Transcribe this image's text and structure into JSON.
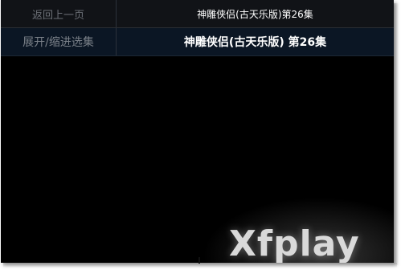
{
  "nav": {
    "back_label": "返回上一页",
    "now_playing_small": "神雕侠侣(古天乐版)第26集"
  },
  "episodes": {
    "expand_label": "展开/缩进选集",
    "current_title": "神雕侠侣(古天乐版) 第26集"
  },
  "player": {
    "watermark": "Xfplay"
  },
  "colors": {
    "background": "#000000",
    "header_row": "#111317",
    "expand_row": "#0b1624",
    "muted_text": "#6b6f76",
    "title_text": "#ffffff"
  }
}
